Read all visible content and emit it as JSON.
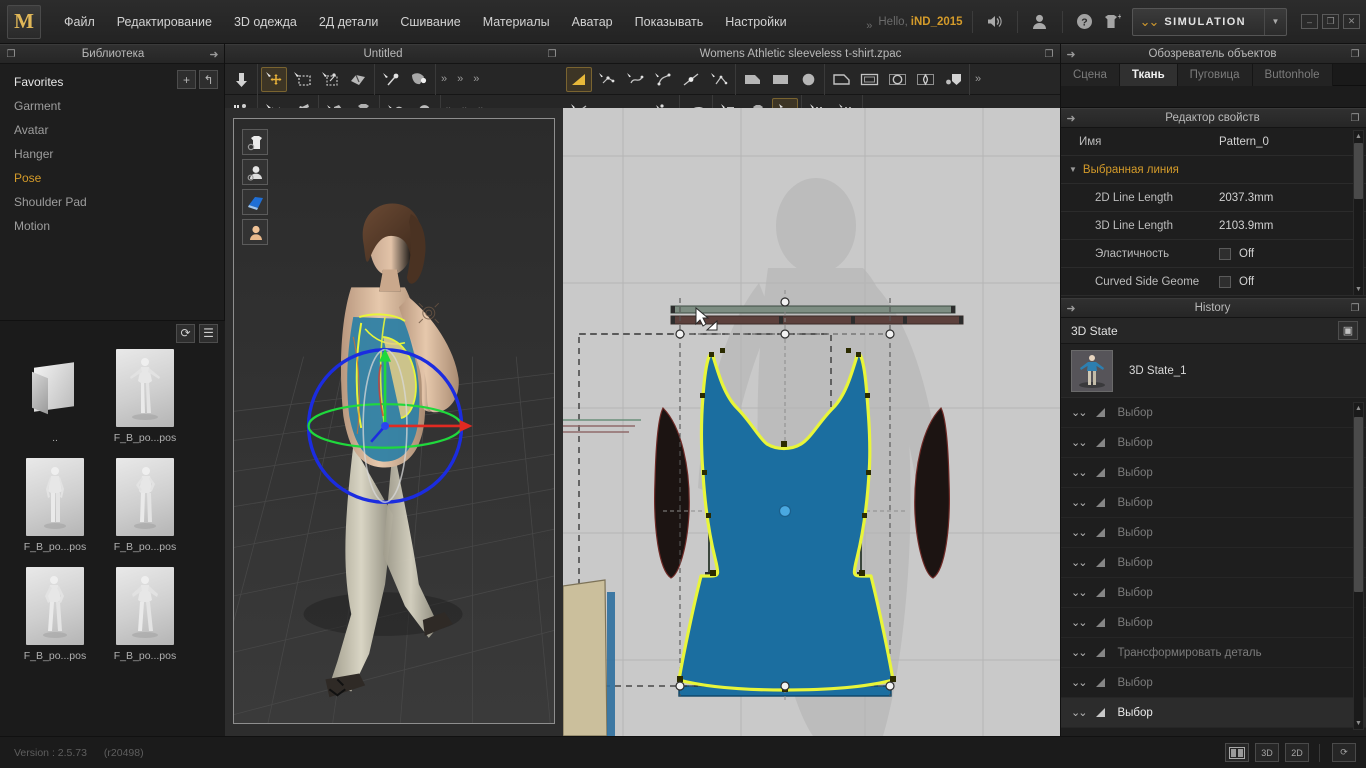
{
  "app": {
    "logo_letter": "M",
    "version_label": "Version : 2.5.73",
    "revision_label": "(r20498)"
  },
  "menu": {
    "items": [
      {
        "label": "Файл"
      },
      {
        "label": "Редактирование"
      },
      {
        "label": "3D одежда"
      },
      {
        "label": "2Д детали"
      },
      {
        "label": "Сшивание"
      },
      {
        "label": "Материалы"
      },
      {
        "label": "Аватар"
      },
      {
        "label": "Показывать"
      },
      {
        "label": "Настройки"
      }
    ],
    "overflow_label": "»",
    "hello_label": "Hello,",
    "user_name": "iND_2015",
    "icons": [
      {
        "name": "speaker-icon",
        "glyph": "🔊"
      },
      {
        "name": "user-icon",
        "glyph": "👤"
      },
      {
        "name": "help-icon",
        "glyph": "?"
      },
      {
        "name": "garment-add-icon",
        "glyph": "👕"
      }
    ],
    "simulation": {
      "label": "SIMULATION",
      "arrow": "▼",
      "accent": "#d19a2e"
    },
    "window": {
      "minimize": "–",
      "restore": "❐",
      "close": "✕"
    }
  },
  "library": {
    "panel_title": "Библиотека",
    "add_label": "+",
    "back_label": "↰",
    "items": [
      {
        "label": "Favorites",
        "state": "fav"
      },
      {
        "label": "Garment",
        "state": "normal"
      },
      {
        "label": "Avatar",
        "state": "normal"
      },
      {
        "label": "Hanger",
        "state": "normal"
      },
      {
        "label": "Pose",
        "state": "selected"
      },
      {
        "label": "Shoulder Pad",
        "state": "normal"
      },
      {
        "label": "Motion",
        "state": "normal"
      }
    ],
    "files_toolbar": {
      "refresh_label": "⟳",
      "list_label": "☰"
    },
    "files": [
      {
        "label": "..",
        "kind": "up"
      },
      {
        "label": "F_B_po...pos",
        "kind": "pose"
      },
      {
        "label": "F_B_po...pos",
        "kind": "pose"
      },
      {
        "label": "F_B_po...pos",
        "kind": "pose"
      },
      {
        "label": "F_B_po...pos",
        "kind": "pose"
      },
      {
        "label": "F_B_po...pos",
        "kind": "pose"
      }
    ]
  },
  "view3d": {
    "panel_title": "Untitled",
    "toolbar_row1": [
      {
        "name": "sync-down-icon",
        "active": false
      },
      {
        "name": "transform-garment-icon",
        "active": true
      },
      {
        "name": "select-mesh-box-icon",
        "active": false
      },
      {
        "name": "select-mesh-icon",
        "active": false
      },
      {
        "name": "fold-arrange-icon",
        "active": false
      },
      {
        "name": "pin-icon",
        "active": false
      },
      {
        "name": "tack-icon",
        "active": false
      }
    ],
    "toolbar_row2": [
      {
        "name": "avatar-walk-icon",
        "active": false
      },
      {
        "name": "scissors-icon",
        "active": false
      },
      {
        "name": "brush-icon",
        "active": false
      },
      {
        "name": "glue-icon",
        "active": false
      },
      {
        "name": "texture-garment-icon",
        "active": false
      },
      {
        "name": "button-place-icon",
        "active": false
      },
      {
        "name": "button-icon",
        "active": false
      }
    ],
    "overflow_label": "»",
    "viewport_tools": [
      {
        "name": "show-garment-icon"
      },
      {
        "name": "show-avatar-icon"
      },
      {
        "name": "show-fabric-icon"
      },
      {
        "name": "show-skin-icon"
      }
    ]
  },
  "view2d": {
    "panel_title": "Womens Athletic sleeveless t-shirt.zpac",
    "toolbar_row1": [
      {
        "name": "edit-pattern-icon",
        "active": true
      },
      {
        "name": "edit-curve-point-icon",
        "active": false
      },
      {
        "name": "edit-curvature-icon",
        "active": false
      },
      {
        "name": "add-point-icon",
        "active": false
      },
      {
        "name": "split-line-icon",
        "active": false
      },
      {
        "name": "segment-icon",
        "active": false
      },
      {
        "name": "polygon-icon",
        "active": false
      },
      {
        "name": "rectangle-icon",
        "active": false
      },
      {
        "name": "circle-icon",
        "active": false
      },
      {
        "name": "internal-polygon-icon",
        "active": false
      },
      {
        "name": "internal-rectangle-icon",
        "active": false
      },
      {
        "name": "internal-circle-icon",
        "active": false
      },
      {
        "name": "dart-icon",
        "active": false
      },
      {
        "name": "internal-shape-icon",
        "active": false
      }
    ],
    "toolbar_row2": [
      {
        "name": "sew-segment-icon",
        "active": false
      },
      {
        "name": "sew-free-icon",
        "active": false
      },
      {
        "name": "sew-curve-icon",
        "active": false
      },
      {
        "name": "sew-check-icon",
        "active": false
      },
      {
        "name": "iron-icon",
        "active": false
      },
      {
        "name": "fold-icon",
        "active": false
      },
      {
        "name": "texture-icon",
        "active": false
      },
      {
        "name": "pattern-fill-icon",
        "active": true
      },
      {
        "name": "grading-icon",
        "active": false
      },
      {
        "name": "grading-edit-icon",
        "active": false
      }
    ],
    "overflow_label": "»"
  },
  "object_browser": {
    "panel_title": "Обозреватель объектов",
    "tabs": [
      {
        "label": "Сцена",
        "active": false
      },
      {
        "label": "Ткань",
        "active": true
      },
      {
        "label": "Пуговица",
        "active": false
      },
      {
        "label": "Buttonhole",
        "active": false
      }
    ]
  },
  "property_editor": {
    "panel_title": "Редактор свойств",
    "rows": [
      {
        "kind": "plain",
        "name": "Имя",
        "value": "Pattern_0"
      },
      {
        "kind": "group",
        "name": "Выбранная линия",
        "value": ""
      },
      {
        "kind": "indent",
        "name": "2D Line Length",
        "value": "2037.3mm"
      },
      {
        "kind": "indent",
        "name": "3D Line Length",
        "value": "2103.9mm"
      },
      {
        "kind": "checkbox",
        "name": "Эластичность",
        "value": "Off"
      },
      {
        "kind": "checkbox",
        "name": "Curved Side Geome",
        "value": "Off"
      }
    ]
  },
  "history": {
    "panel_title": "History",
    "header_label": "3D State",
    "snapshot_button": "▣",
    "state": {
      "label": "3D State_1"
    },
    "rows": [
      {
        "label": "Выбор",
        "current": false
      },
      {
        "label": "Выбор",
        "current": false
      },
      {
        "label": "Выбор",
        "current": false
      },
      {
        "label": "Выбор",
        "current": false
      },
      {
        "label": "Выбор",
        "current": false
      },
      {
        "label": "Выбор",
        "current": false
      },
      {
        "label": "Выбор",
        "current": false
      },
      {
        "label": "Выбор",
        "current": false
      },
      {
        "label": "Трансформировать деталь",
        "current": false
      },
      {
        "label": "Выбор",
        "current": false
      },
      {
        "label": "Выбор",
        "current": true
      }
    ]
  },
  "statusbar": {
    "buttons": [
      {
        "name": "layout-split-button",
        "label": "▥"
      },
      {
        "name": "view-3d-button",
        "label": "3D"
      },
      {
        "name": "view-2d-button",
        "label": "2D"
      },
      {
        "name": "refresh-button",
        "label": "⟳"
      }
    ]
  },
  "colors": {
    "accent": "#d49b2a",
    "pattern_fill": "#1b6ea0",
    "pattern_outline": "#e8f53a",
    "background": "#232323",
    "panel": "#1e1e1e",
    "viewport_2d": "#c9c9c9"
  }
}
